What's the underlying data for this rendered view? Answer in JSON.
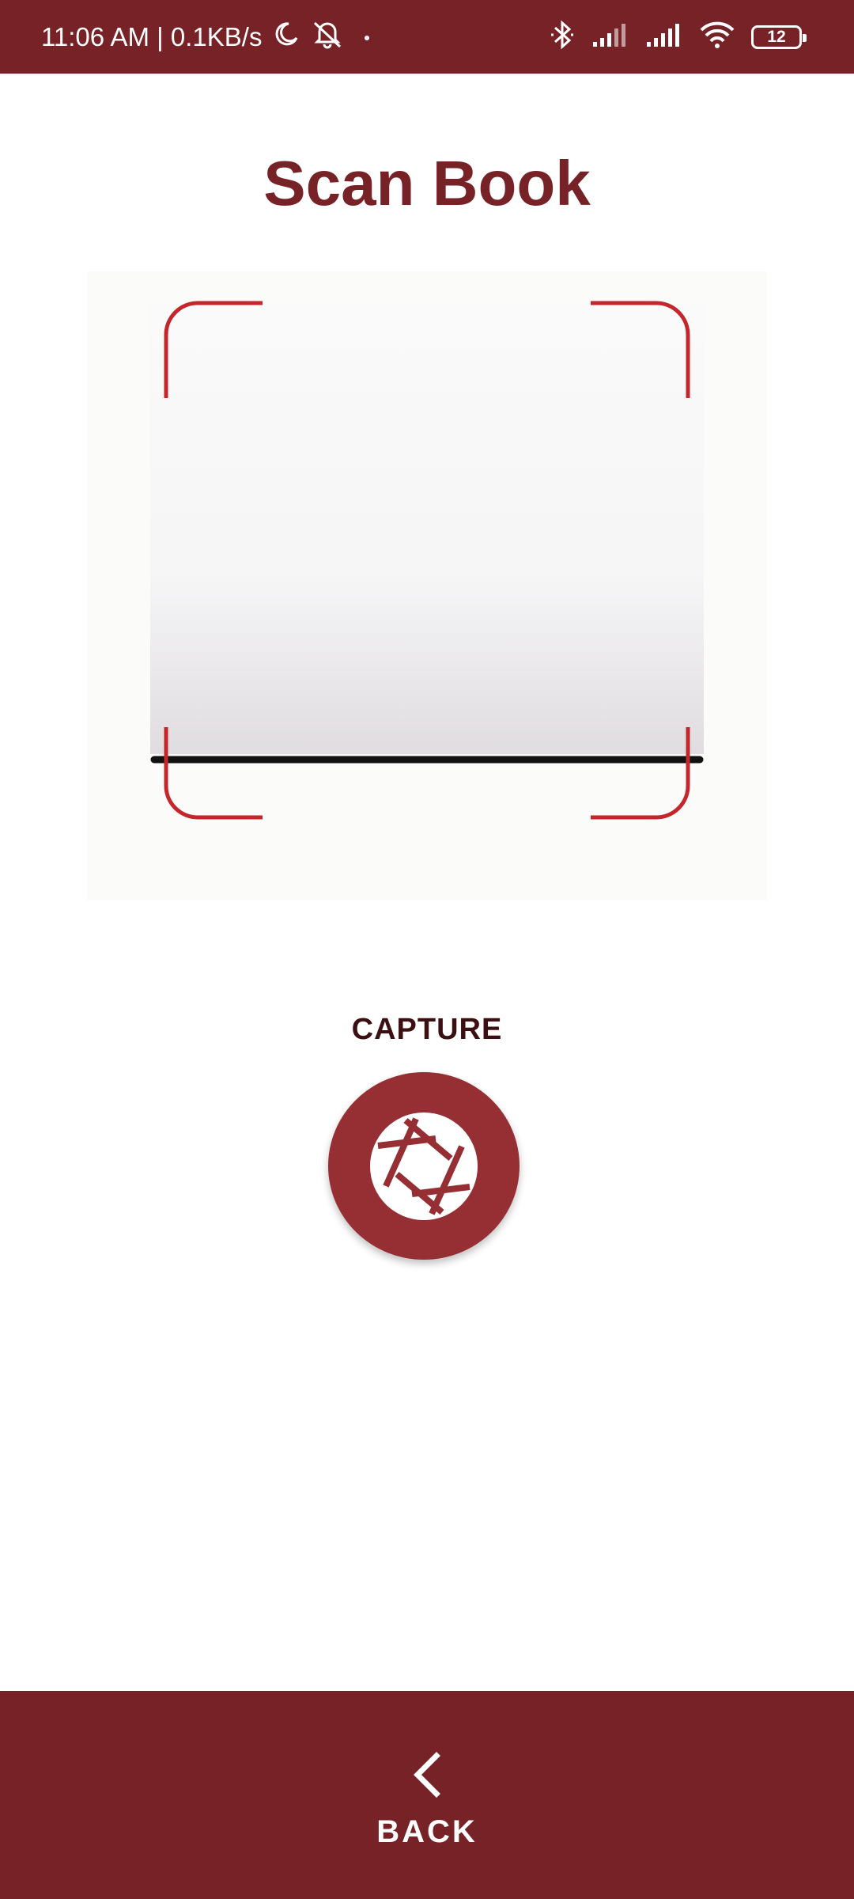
{
  "status_bar": {
    "time_and_speed": "11:06 AM | 0.1KB/s",
    "battery_level": "12",
    "icons": [
      "moon-icon",
      "mute-notifications-icon",
      "dot-icon",
      "bluetooth-icon",
      "signal-icon",
      "signal-icon",
      "wifi-icon",
      "battery-icon"
    ],
    "background_color": "#762226"
  },
  "page": {
    "title": "Scan Book"
  },
  "scanner": {
    "frame_color": "#c4262b",
    "icon": "scan-frame-icon"
  },
  "capture": {
    "label": "CAPTURE",
    "icon": "camera-shutter-icon",
    "button_color": "#962f34"
  },
  "bottom_bar": {
    "back_label": "BACK",
    "back_icon": "chevron-left-icon",
    "background_color": "#762226"
  }
}
